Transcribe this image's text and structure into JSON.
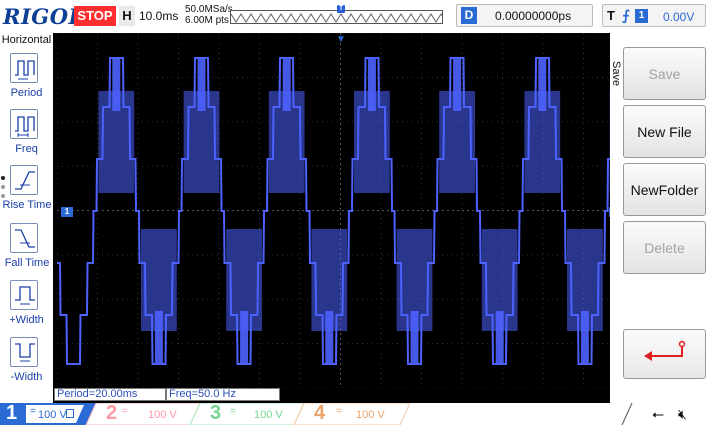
{
  "brand": "RIGOL",
  "run_status": "STOP",
  "horizontal": {
    "key": "H",
    "timebase": "10.0ms",
    "sample_rate": "50.0MSa/s",
    "memory_depth": "6.00M pts"
  },
  "delay": {
    "key": "D",
    "value": "0.00000000ps"
  },
  "trigger": {
    "key": "T",
    "source": "1",
    "level": "0.00V"
  },
  "left_menu": {
    "title": "Horizontal",
    "items": [
      {
        "label": "Period",
        "icon": "period-icon"
      },
      {
        "label": "Freq",
        "icon": "freq-icon"
      },
      {
        "label": "Rise Time",
        "icon": "rise-time-icon"
      },
      {
        "label": "Fall Time",
        "icon": "fall-time-icon"
      },
      {
        "label": "+Width",
        "icon": "positive-width-icon"
      },
      {
        "label": "-Width",
        "icon": "negative-width-icon"
      }
    ]
  },
  "right_menu": {
    "title": "Save",
    "buttons": [
      {
        "label": "Save",
        "enabled": false
      },
      {
        "label": "New File",
        "enabled": true
      },
      {
        "label": "NewFolder",
        "enabled": true
      },
      {
        "label": "Delete",
        "enabled": false
      },
      {
        "label": "",
        "icon": "return-arrow-icon",
        "enabled": true
      }
    ]
  },
  "channel_marker": "1",
  "trigger_level_marker": "T",
  "measurements": [
    {
      "text": "Period=20.00ms"
    },
    {
      "text": "Freq=50.0 Hz"
    }
  ],
  "channels": [
    {
      "num": "1",
      "coupling": "=",
      "scale": "100 V",
      "color": "#2a6bd6",
      "active": true
    },
    {
      "num": "2",
      "coupling": "=",
      "scale": "100 V",
      "color": "#ff9aa8",
      "active": false
    },
    {
      "num": "3",
      "coupling": "=",
      "scale": "100 V",
      "color": "#74d68f",
      "active": false
    },
    {
      "num": "4",
      "coupling": "=",
      "scale": "100 V",
      "color": "#e9a36b",
      "active": false
    }
  ],
  "colors": {
    "waveform": "#4d62ff",
    "accent": "#2a6bd6",
    "stop": "#ff2f2f",
    "brand": "#0d3f95"
  }
}
